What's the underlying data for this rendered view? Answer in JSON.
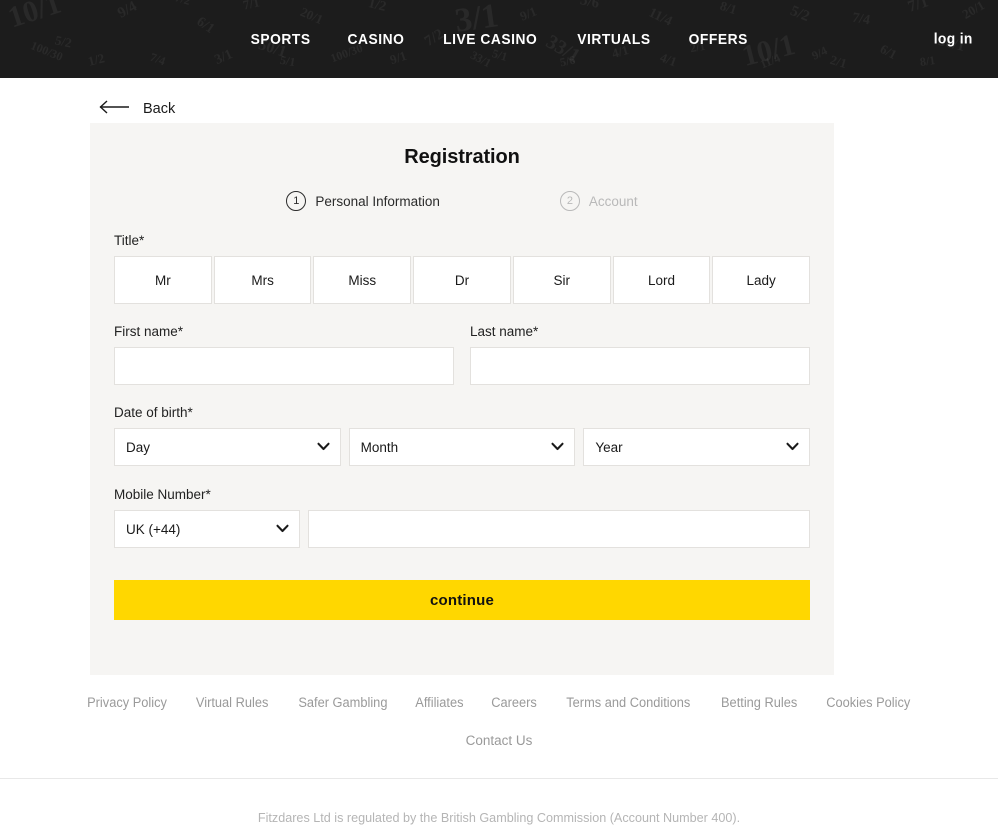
{
  "header": {
    "nav_items": [
      {
        "label": "SPORTS",
        "name": "sports"
      },
      {
        "label": "CASINO",
        "name": "casino"
      },
      {
        "label": "LIVE CASINO",
        "name": "live-casino"
      },
      {
        "label": "VIRTUALS",
        "name": "virtuals"
      },
      {
        "label": "OFFERS",
        "name": "offers"
      }
    ],
    "login_label": "log in",
    "background_color": "#1c1c1c",
    "pattern_odds": [
      "10/1",
      "5/2",
      "9/4",
      "7/4",
      "6/1",
      "7/1",
      "50/1",
      "20/1",
      "100/30",
      "1/2",
      "7/2",
      "3/1",
      "5/1",
      "9/1",
      "33/1",
      "5/6",
      "4/1",
      "11/4",
      "2/1",
      "8/1"
    ]
  },
  "back": {
    "label": "Back",
    "icon": "arrow-left-icon"
  },
  "card": {
    "title": "Registration",
    "steps": [
      {
        "number": "1",
        "label": "Personal Information",
        "active": true
      },
      {
        "number": "2",
        "label": "Account",
        "active": false
      }
    ],
    "title_field": {
      "label": "Title*",
      "options": [
        "Mr",
        "Mrs",
        "Miss",
        "Dr",
        "Sir",
        "Lord",
        "Lady"
      ]
    },
    "first_name": {
      "label": "First name*",
      "value": "",
      "placeholder": ""
    },
    "last_name": {
      "label": "Last name*",
      "value": "",
      "placeholder": ""
    },
    "date_of_birth": {
      "label": "Date of birth*",
      "day": "Day",
      "month": "Month",
      "year": "Year"
    },
    "mobile": {
      "label": "Mobile Number*",
      "country_code": "UK (+44)",
      "number": "",
      "placeholder": ""
    },
    "continue_label": "continue",
    "accent_color": "#ffd700",
    "background_color": "#f6f5f3"
  },
  "footer": {
    "links": [
      "Privacy Policy",
      "Virtual Rules",
      "Safer Gambling",
      "Affiliates",
      "Careers",
      "Terms and Conditions",
      "Betting Rules",
      "Cookies Policy"
    ],
    "contact_label": "Contact Us",
    "regulatory_note": "Fitzdares Ltd is regulated by the British Gambling Commission (Account Number 400)."
  }
}
